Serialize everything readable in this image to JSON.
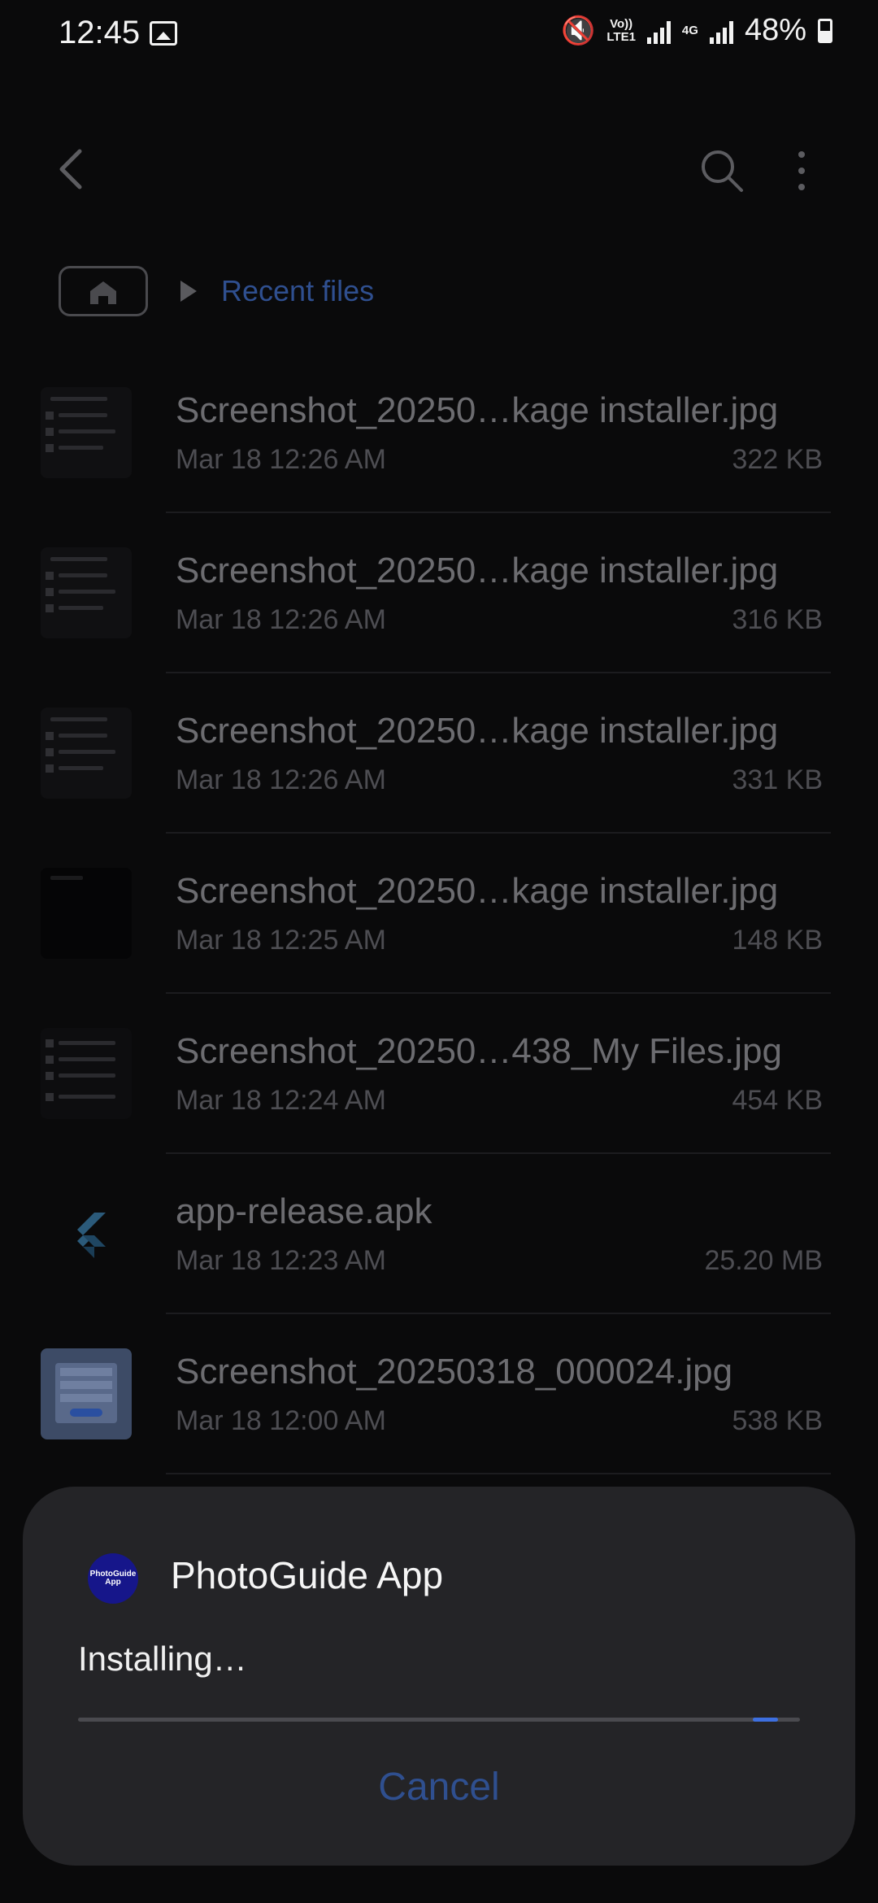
{
  "status_bar": {
    "time": "12:45",
    "network_top": "Vo))",
    "network_bottom": "LTE1",
    "network_4g": "4G",
    "battery": "48%"
  },
  "breadcrumb": {
    "label": "Recent files"
  },
  "files": [
    {
      "name": "Screenshot_20250…kage installer.jpg",
      "date": "Mar 18 12:26 AM",
      "size": "322 KB"
    },
    {
      "name": "Screenshot_20250…kage installer.jpg",
      "date": "Mar 18 12:26 AM",
      "size": "316 KB"
    },
    {
      "name": "Screenshot_20250…kage installer.jpg",
      "date": "Mar 18 12:26 AM",
      "size": "331 KB"
    },
    {
      "name": "Screenshot_20250…kage installer.jpg",
      "date": "Mar 18 12:25 AM",
      "size": "148 KB"
    },
    {
      "name": "Screenshot_20250…438_My Files.jpg",
      "date": "Mar 18 12:24 AM",
      "size": "454 KB"
    },
    {
      "name": "app-release.apk",
      "date": "Mar 18 12:23 AM",
      "size": "25.20 MB"
    },
    {
      "name": "Screenshot_20250318_000024.jpg",
      "date": "Mar 18 12:00 AM",
      "size": "538 KB"
    }
  ],
  "dialog": {
    "app_name": "PhotoGuide App",
    "icon_text_1": "PhotoGuide",
    "icon_text_2": "App",
    "status": "Installing…",
    "progress": 0.97,
    "cancel_label": "Cancel"
  },
  "colors": {
    "accent": "#2f4f8f",
    "progress": "#3d6fe0",
    "background": "#0a0a0b",
    "dialog": "#242427"
  }
}
